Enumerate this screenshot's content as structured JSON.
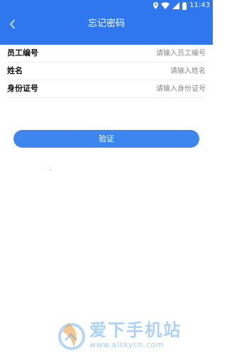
{
  "status_bar": {
    "time": "11:43",
    "icons": [
      "location-icon",
      "wifi-icon",
      "signal-icon",
      "battery-icon"
    ]
  },
  "nav": {
    "title": "忘记密码",
    "back_icon": "chevron-left-icon"
  },
  "form": {
    "fields": [
      {
        "label": "员工编号",
        "placeholder": "请输入员工编号",
        "value": ""
      },
      {
        "label": "姓名",
        "placeholder": "请输入姓名",
        "value": ""
      },
      {
        "label": "身份证号",
        "placeholder": "请输入身份证号",
        "value": ""
      }
    ]
  },
  "actions": {
    "verify_label": "验证"
  },
  "watermark": {
    "title": "爱下手机站",
    "url": "www.aiskycn.com"
  },
  "colors": {
    "header": "#2f77ee",
    "button": "#3d86f0",
    "watermark": "#6aaef0"
  }
}
